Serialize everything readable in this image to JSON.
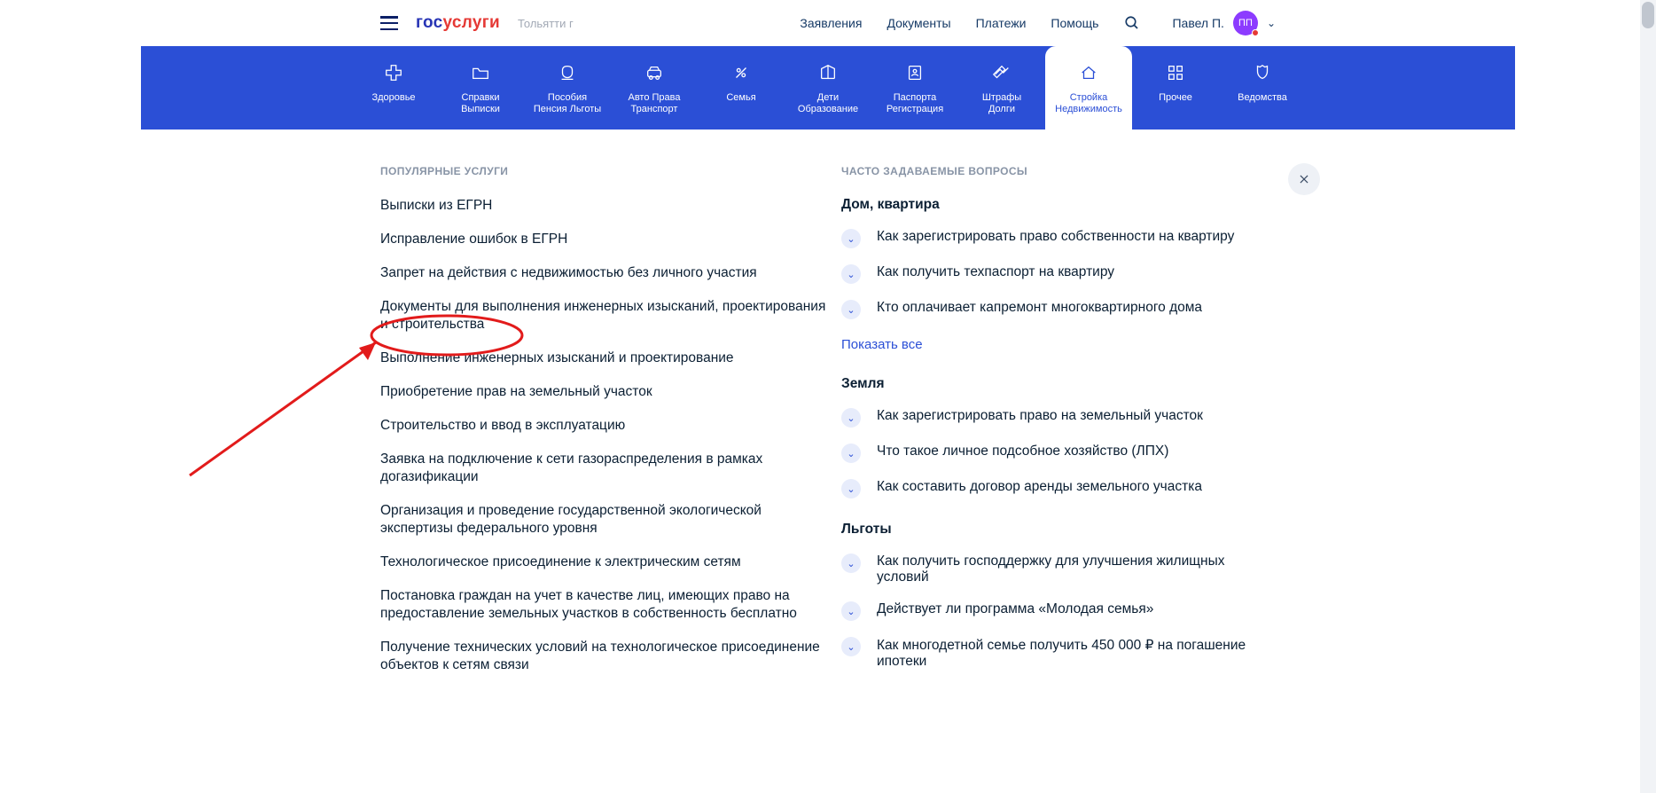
{
  "header": {
    "logo_blue": "гос",
    "logo_red": "услуги",
    "region": "Тольятти г",
    "links": [
      "Заявления",
      "Документы",
      "Платежи",
      "Помощь"
    ],
    "user_name": "Павел П.",
    "avatar_initials": "ПП"
  },
  "categories": [
    {
      "label": "Здоровье"
    },
    {
      "label": "Справки\nВыписки"
    },
    {
      "label": "Пособия\nПенсия Льготы"
    },
    {
      "label": "Авто Права\nТранспорт"
    },
    {
      "label": "Семья"
    },
    {
      "label": "Дети\nОбразование"
    },
    {
      "label": "Паспорта\nРегистрация"
    },
    {
      "label": "Штрафы\nДолги"
    },
    {
      "label": "Стройка\nНедвижимость",
      "active": true
    },
    {
      "label": "Прочее"
    },
    {
      "label": "Ведомства"
    }
  ],
  "left_section_title": "ПОПУЛЯРНЫЕ УСЛУГИ",
  "services": [
    "Выписки из ЕГРН",
    "Исправление ошибок в ЕГРН",
    "Запрет на действия с недвижимостью без личного участия",
    "Документы для выполнения инженерных изысканий, проектирования и строительства",
    "Выполнение инженерных изысканий и проектирование",
    "Приобретение прав на земельный участок",
    "Строительство и ввод в эксплуатацию",
    "Заявка на подключение к сети газораспределения в рамках догазификации",
    "Организация и проведение государственной экологической экспертизы федерального уровня",
    "Технологическое присоединение к электрическим сетям",
    "Постановка граждан на учет в качестве лиц, имеющих право на предоставление земельных участков в собственность бесплатно",
    "Получение технических условий на технологическое присоединение объектов к сетям связи"
  ],
  "right_section_title": "ЧАСТО ЗАДАВАЕМЫЕ ВОПРОСЫ",
  "faq": [
    {
      "title": "Дом, квартира",
      "items": [
        "Как зарегистрировать право собственности на квартиру",
        "Как получить техпаспорт на квартиру",
        "Кто оплачивает капремонт многоквартирного дома"
      ],
      "show_all": "Показать все"
    },
    {
      "title": "Земля",
      "items": [
        "Как зарегистрировать право на земельный участок",
        "Что такое личное подсобное хозяйство (ЛПХ)",
        "Как составить договор аренды земельного участка"
      ]
    },
    {
      "title": "Льготы",
      "items": [
        "Как получить господдержку для улучшения жилищных условий",
        "Действует ли программа «Молодая семья»",
        "Как многодетной семье получить 450 000 ₽ на погашение ипотеки"
      ]
    }
  ]
}
